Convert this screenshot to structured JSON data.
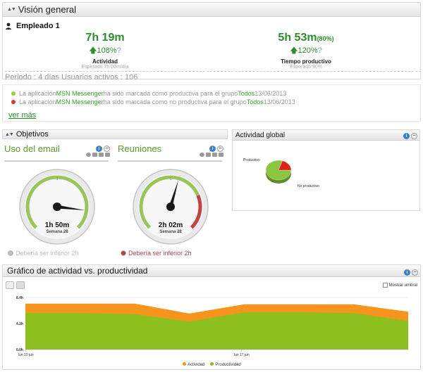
{
  "overview": {
    "title": "Visión general",
    "employee": "Empleado 1",
    "activity": {
      "value": "7h 19m",
      "pct": "108%",
      "q": "?",
      "label": "Actividad",
      "expected": "Esperado 7h 00m/día"
    },
    "productive": {
      "value": "5h 53m",
      "value_sub": "(80%)",
      "pct": "120%",
      "q": "?",
      "label": "Tiempo productivo",
      "expected": "Esperado 90%"
    },
    "period": "Periodo : 4 días Usuarios activos : 106"
  },
  "events": {
    "items": [
      {
        "pre": "La aplicación ",
        "app": "MSN Messenger",
        "mid": " ha sido marcada como productiva para el grupo ",
        "group": "Todos",
        "date": " 13/06/2013",
        "color": "#9acd32"
      },
      {
        "pre": "La aplicación ",
        "app": "MSN Messenger",
        "mid": " ha sido marcada como no productiva para el grupo ",
        "group": "Todos",
        "date": " 13/06/2013",
        "color": "#d93a2b"
      }
    ],
    "more": "ver más"
  },
  "objetivos": {
    "title": "Objetivos",
    "gauges": [
      {
        "title": "Uso del email",
        "value": "1h 50m",
        "week": "Semana 28",
        "tick_top": "1",
        "level": 0.86,
        "note": "Debería ser inferior 2h",
        "note_color": "#bdbdbd",
        "note_text_color": "#bdbdbd"
      },
      {
        "title": "Reuniones",
        "value": "2h 02m",
        "week": "Semana 28",
        "tick_top": "1",
        "level": 0.56,
        "note": "Debería ser inferior 2h",
        "note_color": "#b04040",
        "note_text_color": "#b04040"
      }
    ]
  },
  "global": {
    "title": "Actividad global",
    "slices": [
      {
        "label": "Productivo",
        "value": 80,
        "color": "#8cc63f"
      },
      {
        "label": "No productivo",
        "value": 20,
        "color": "#e0201b"
      }
    ]
  },
  "chart": {
    "title": "Gráfico de actividad vs. productividad",
    "threshold_label": "Mostrar umbral",
    "chart_data": {
      "type": "area",
      "x_ticks": [
        "lun 10 jun",
        "lun 17 jun"
      ],
      "y_ticks": [
        "8.4h",
        "4.2h",
        "0.0h"
      ],
      "ylim": [
        0,
        8.4
      ],
      "x": [
        0,
        1,
        2,
        3,
        4,
        5,
        6,
        7
      ],
      "series": [
        {
          "name": "Actividad",
          "color": "#f7941d",
          "values": [
            7.4,
            7.4,
            7.4,
            5.8,
            7.3,
            7.3,
            7.3,
            6.1
          ]
        },
        {
          "name": "Productividad",
          "color": "#8dbf1e",
          "values": [
            5.9,
            5.9,
            5.7,
            4.5,
            6.0,
            6.0,
            5.9,
            4.6
          ]
        }
      ]
    }
  }
}
